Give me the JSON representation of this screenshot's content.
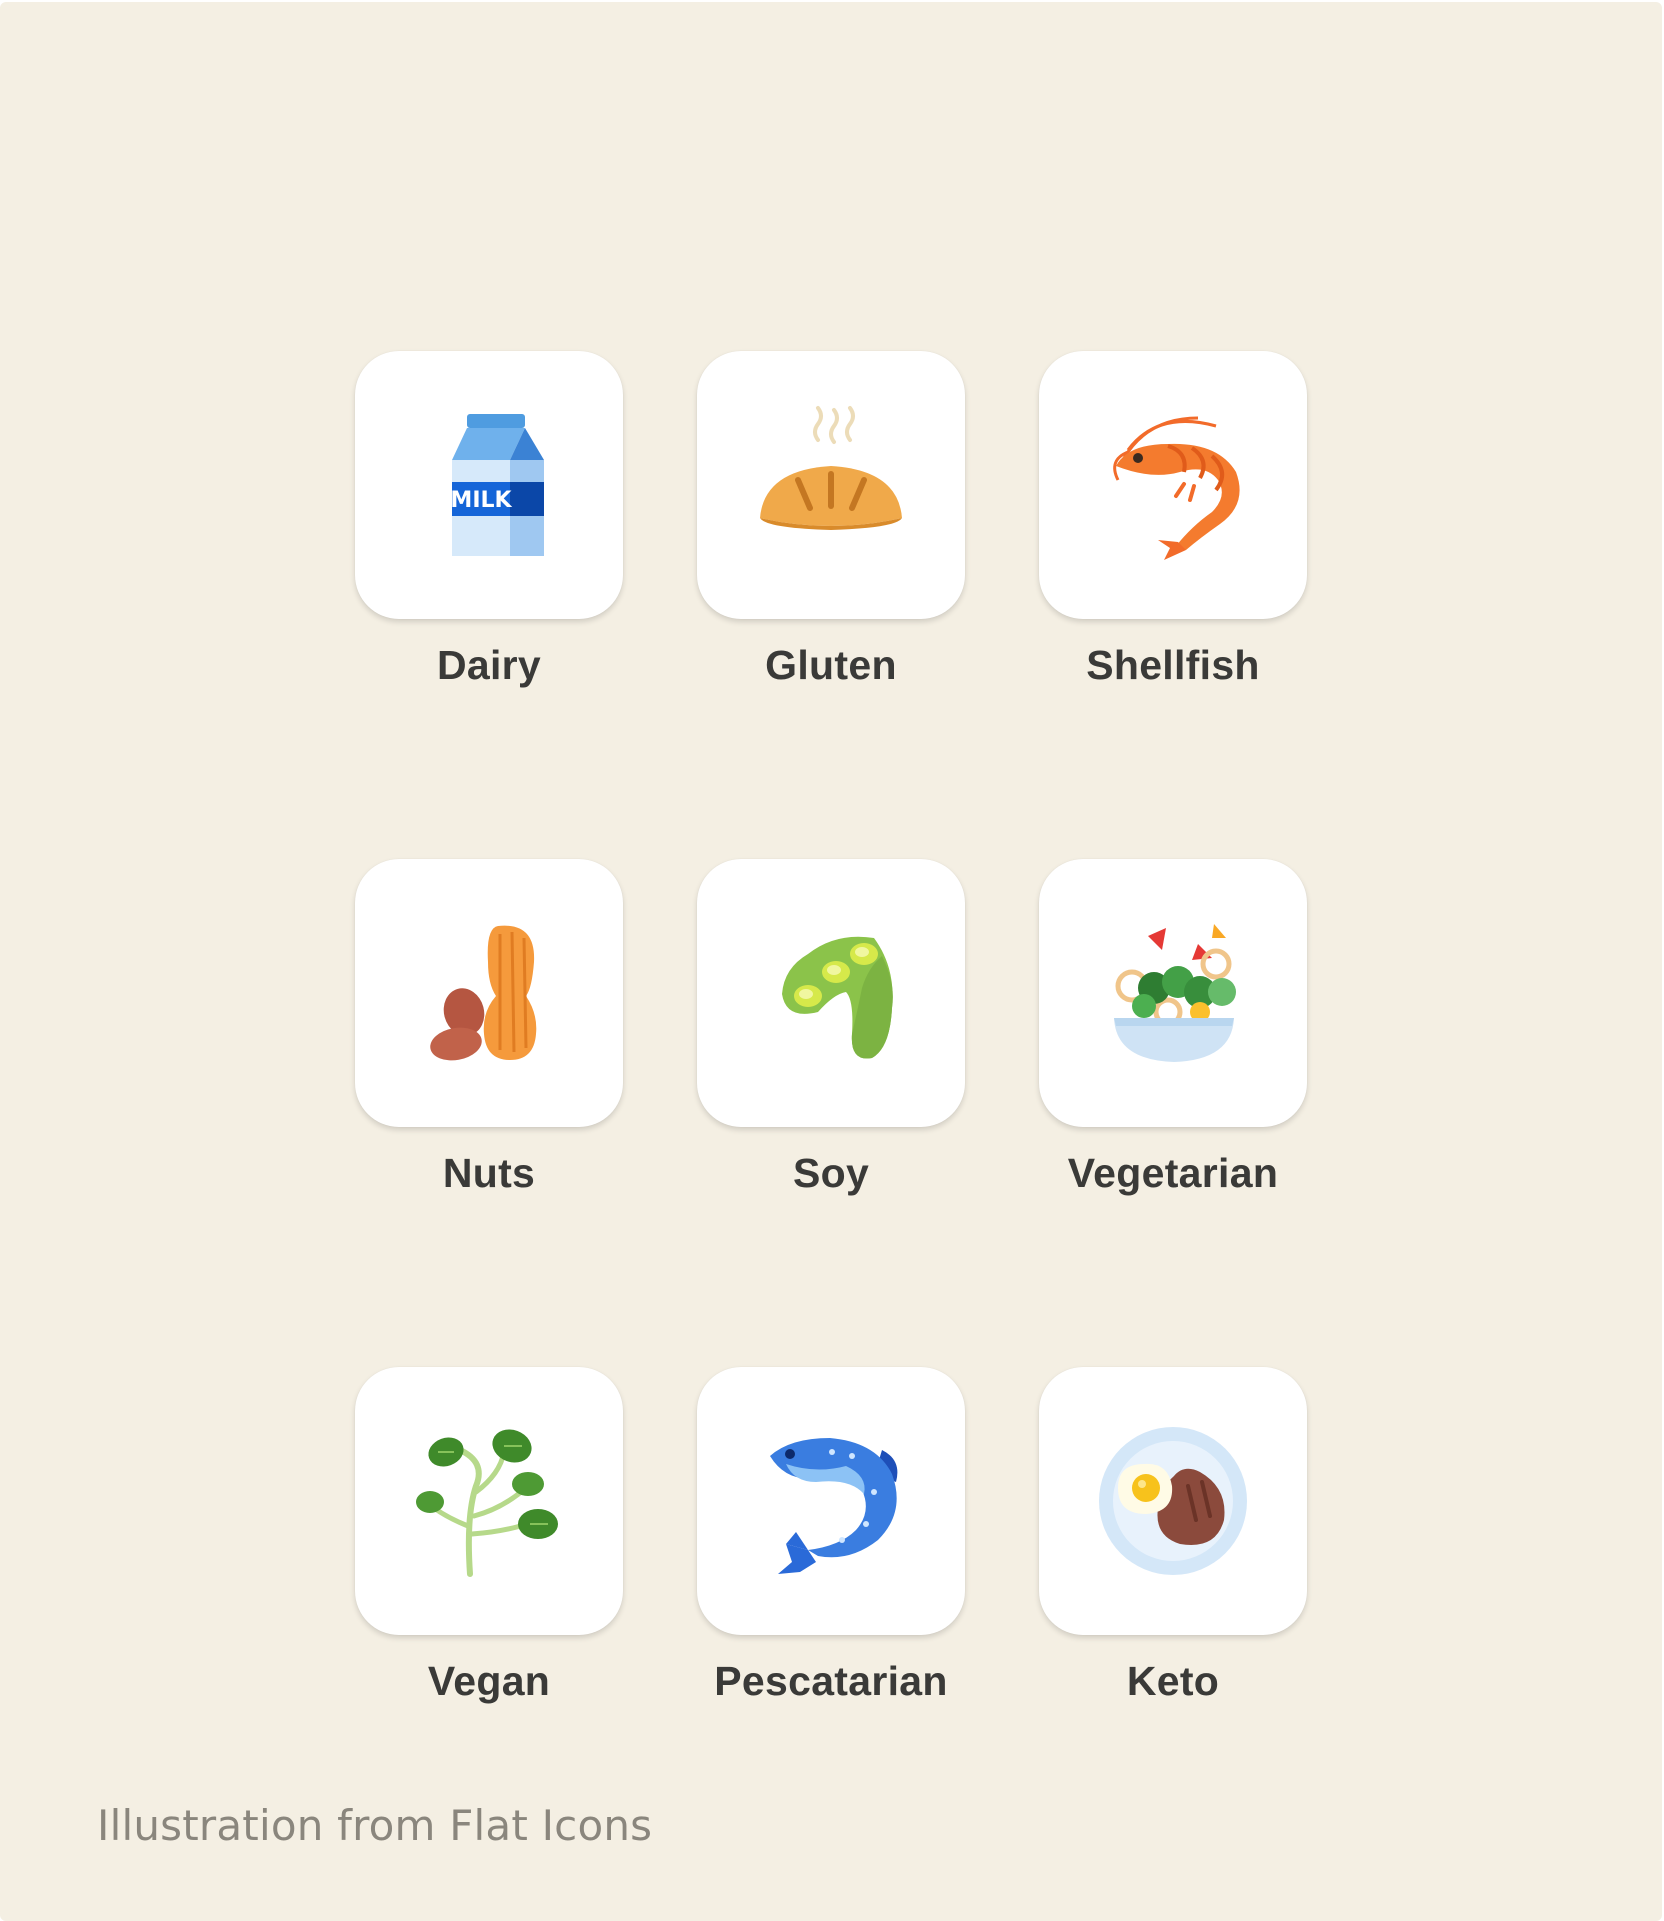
{
  "options": [
    {
      "label": "Dairy",
      "icon": "milk-carton-icon"
    },
    {
      "label": "Gluten",
      "icon": "bread-loaf-icon"
    },
    {
      "label": "Shellfish",
      "icon": "shrimp-icon"
    },
    {
      "label": "Nuts",
      "icon": "peanut-icon"
    },
    {
      "label": "Soy",
      "icon": "soybean-pod-icon"
    },
    {
      "label": "Vegetarian",
      "icon": "salad-bowl-icon"
    },
    {
      "label": "Vegan",
      "icon": "leafy-sprout-icon"
    },
    {
      "label": "Pescatarian",
      "icon": "fish-icon"
    },
    {
      "label": "Keto",
      "icon": "steak-egg-plate-icon"
    }
  ],
  "milk_text": "MILK",
  "credit": "Illustration from Flat Icons",
  "colors": {
    "background": "#f4efe3",
    "tile": "#ffffff",
    "label": "#3a3a38",
    "credit": "#8a867d"
  }
}
